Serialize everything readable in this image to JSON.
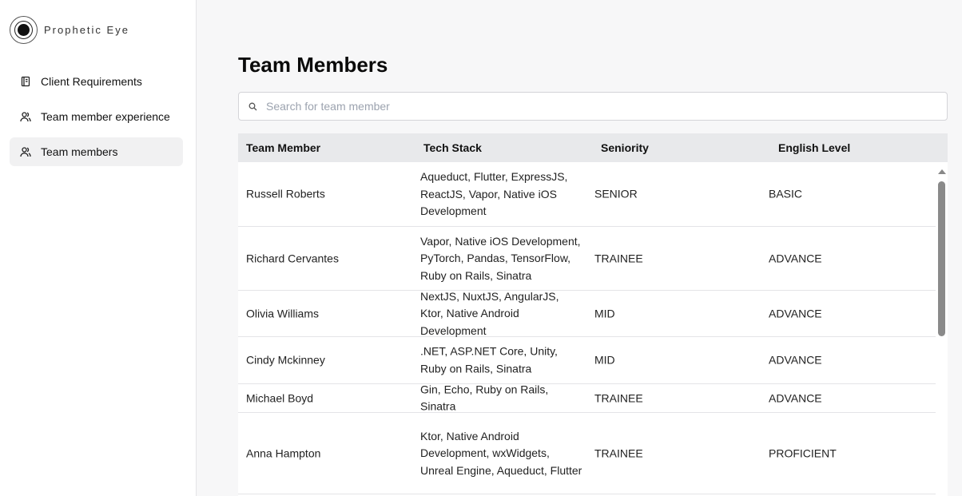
{
  "brand": {
    "name": "Prophetic Eye"
  },
  "sidebar": {
    "items": [
      {
        "label": "Client Requirements",
        "icon": "notebook-icon",
        "active": false
      },
      {
        "label": "Team member experience",
        "icon": "users-icon",
        "active": false
      },
      {
        "label": "Team members",
        "icon": "users-icon",
        "active": true
      }
    ]
  },
  "main": {
    "title": "Team Members",
    "search": {
      "placeholder": "Search for team member",
      "value": ""
    },
    "table": {
      "columns": [
        "Team Member",
        "Tech Stack",
        "Seniority",
        "English Level"
      ],
      "rows": [
        {
          "name": "Russell Roberts",
          "stack": "Aqueduct, Flutter, ExpressJS, ReactJS, Vapor, Native iOS Development",
          "seniority": "SENIOR",
          "english": "BASIC"
        },
        {
          "name": "Richard Cervantes",
          "stack": "Vapor, Native iOS Development, PyTorch, Pandas, TensorFlow, Ruby on Rails, Sinatra",
          "seniority": "TRAINEE",
          "english": "ADVANCE"
        },
        {
          "name": "Olivia Williams",
          "stack": "NextJS, NuxtJS, AngularJS, Ktor, Native Android Development",
          "seniority": "MID",
          "english": "ADVANCE"
        },
        {
          "name": "Cindy Mckinney",
          "stack": ".NET, ASP.NET Core, Unity, Ruby on Rails, Sinatra",
          "seniority": "MID",
          "english": "ADVANCE"
        },
        {
          "name": "Michael Boyd",
          "stack": "Gin, Echo, Ruby on Rails, Sinatra",
          "seniority": "TRAINEE",
          "english": "ADVANCE"
        },
        {
          "name": "Anna Hampton",
          "stack": "Ktor, Native Android Development, wxWidgets, Unreal Engine, Aqueduct, Flutter",
          "seniority": "TRAINEE",
          "english": "PROFICIENT"
        }
      ]
    }
  },
  "colors": {
    "sidebar_bg": "#ffffff",
    "page_bg": "#f7f7f8",
    "header_bg": "#e8e9eb",
    "active_item_bg": "#f1f1f2",
    "border": "#e4e4e7"
  }
}
